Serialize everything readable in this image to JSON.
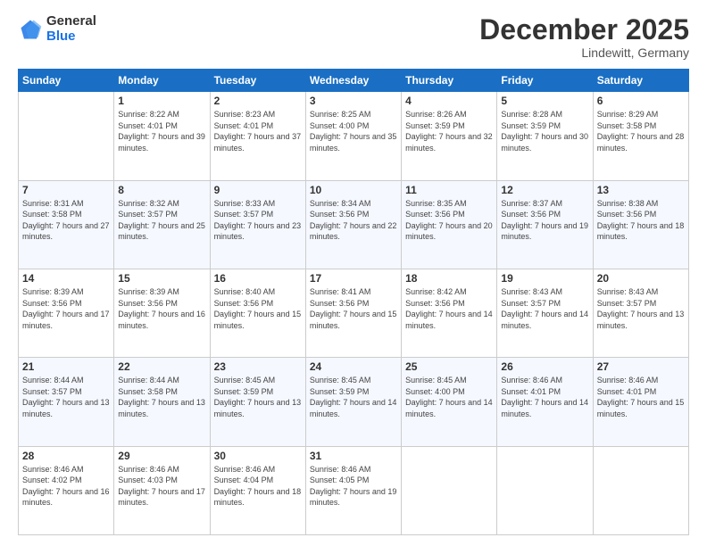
{
  "logo": {
    "general": "General",
    "blue": "Blue"
  },
  "title": "December 2025",
  "subtitle": "Lindewitt, Germany",
  "weekdays": [
    "Sunday",
    "Monday",
    "Tuesday",
    "Wednesday",
    "Thursday",
    "Friday",
    "Saturday"
  ],
  "weeks": [
    [
      {
        "day": "",
        "sunrise": "",
        "sunset": "",
        "daylight": ""
      },
      {
        "day": "1",
        "sunrise": "Sunrise: 8:22 AM",
        "sunset": "Sunset: 4:01 PM",
        "daylight": "Daylight: 7 hours and 39 minutes."
      },
      {
        "day": "2",
        "sunrise": "Sunrise: 8:23 AM",
        "sunset": "Sunset: 4:01 PM",
        "daylight": "Daylight: 7 hours and 37 minutes."
      },
      {
        "day": "3",
        "sunrise": "Sunrise: 8:25 AM",
        "sunset": "Sunset: 4:00 PM",
        "daylight": "Daylight: 7 hours and 35 minutes."
      },
      {
        "day": "4",
        "sunrise": "Sunrise: 8:26 AM",
        "sunset": "Sunset: 3:59 PM",
        "daylight": "Daylight: 7 hours and 32 minutes."
      },
      {
        "day": "5",
        "sunrise": "Sunrise: 8:28 AM",
        "sunset": "Sunset: 3:59 PM",
        "daylight": "Daylight: 7 hours and 30 minutes."
      },
      {
        "day": "6",
        "sunrise": "Sunrise: 8:29 AM",
        "sunset": "Sunset: 3:58 PM",
        "daylight": "Daylight: 7 hours and 28 minutes."
      }
    ],
    [
      {
        "day": "7",
        "sunrise": "Sunrise: 8:31 AM",
        "sunset": "Sunset: 3:58 PM",
        "daylight": "Daylight: 7 hours and 27 minutes."
      },
      {
        "day": "8",
        "sunrise": "Sunrise: 8:32 AM",
        "sunset": "Sunset: 3:57 PM",
        "daylight": "Daylight: 7 hours and 25 minutes."
      },
      {
        "day": "9",
        "sunrise": "Sunrise: 8:33 AM",
        "sunset": "Sunset: 3:57 PM",
        "daylight": "Daylight: 7 hours and 23 minutes."
      },
      {
        "day": "10",
        "sunrise": "Sunrise: 8:34 AM",
        "sunset": "Sunset: 3:56 PM",
        "daylight": "Daylight: 7 hours and 22 minutes."
      },
      {
        "day": "11",
        "sunrise": "Sunrise: 8:35 AM",
        "sunset": "Sunset: 3:56 PM",
        "daylight": "Daylight: 7 hours and 20 minutes."
      },
      {
        "day": "12",
        "sunrise": "Sunrise: 8:37 AM",
        "sunset": "Sunset: 3:56 PM",
        "daylight": "Daylight: 7 hours and 19 minutes."
      },
      {
        "day": "13",
        "sunrise": "Sunrise: 8:38 AM",
        "sunset": "Sunset: 3:56 PM",
        "daylight": "Daylight: 7 hours and 18 minutes."
      }
    ],
    [
      {
        "day": "14",
        "sunrise": "Sunrise: 8:39 AM",
        "sunset": "Sunset: 3:56 PM",
        "daylight": "Daylight: 7 hours and 17 minutes."
      },
      {
        "day": "15",
        "sunrise": "Sunrise: 8:39 AM",
        "sunset": "Sunset: 3:56 PM",
        "daylight": "Daylight: 7 hours and 16 minutes."
      },
      {
        "day": "16",
        "sunrise": "Sunrise: 8:40 AM",
        "sunset": "Sunset: 3:56 PM",
        "daylight": "Daylight: 7 hours and 15 minutes."
      },
      {
        "day": "17",
        "sunrise": "Sunrise: 8:41 AM",
        "sunset": "Sunset: 3:56 PM",
        "daylight": "Daylight: 7 hours and 15 minutes."
      },
      {
        "day": "18",
        "sunrise": "Sunrise: 8:42 AM",
        "sunset": "Sunset: 3:56 PM",
        "daylight": "Daylight: 7 hours and 14 minutes."
      },
      {
        "day": "19",
        "sunrise": "Sunrise: 8:43 AM",
        "sunset": "Sunset: 3:57 PM",
        "daylight": "Daylight: 7 hours and 14 minutes."
      },
      {
        "day": "20",
        "sunrise": "Sunrise: 8:43 AM",
        "sunset": "Sunset: 3:57 PM",
        "daylight": "Daylight: 7 hours and 13 minutes."
      }
    ],
    [
      {
        "day": "21",
        "sunrise": "Sunrise: 8:44 AM",
        "sunset": "Sunset: 3:57 PM",
        "daylight": "Daylight: 7 hours and 13 minutes."
      },
      {
        "day": "22",
        "sunrise": "Sunrise: 8:44 AM",
        "sunset": "Sunset: 3:58 PM",
        "daylight": "Daylight: 7 hours and 13 minutes."
      },
      {
        "day": "23",
        "sunrise": "Sunrise: 8:45 AM",
        "sunset": "Sunset: 3:59 PM",
        "daylight": "Daylight: 7 hours and 13 minutes."
      },
      {
        "day": "24",
        "sunrise": "Sunrise: 8:45 AM",
        "sunset": "Sunset: 3:59 PM",
        "daylight": "Daylight: 7 hours and 14 minutes."
      },
      {
        "day": "25",
        "sunrise": "Sunrise: 8:45 AM",
        "sunset": "Sunset: 4:00 PM",
        "daylight": "Daylight: 7 hours and 14 minutes."
      },
      {
        "day": "26",
        "sunrise": "Sunrise: 8:46 AM",
        "sunset": "Sunset: 4:01 PM",
        "daylight": "Daylight: 7 hours and 14 minutes."
      },
      {
        "day": "27",
        "sunrise": "Sunrise: 8:46 AM",
        "sunset": "Sunset: 4:01 PM",
        "daylight": "Daylight: 7 hours and 15 minutes."
      }
    ],
    [
      {
        "day": "28",
        "sunrise": "Sunrise: 8:46 AM",
        "sunset": "Sunset: 4:02 PM",
        "daylight": "Daylight: 7 hours and 16 minutes."
      },
      {
        "day": "29",
        "sunrise": "Sunrise: 8:46 AM",
        "sunset": "Sunset: 4:03 PM",
        "daylight": "Daylight: 7 hours and 17 minutes."
      },
      {
        "day": "30",
        "sunrise": "Sunrise: 8:46 AM",
        "sunset": "Sunset: 4:04 PM",
        "daylight": "Daylight: 7 hours and 18 minutes."
      },
      {
        "day": "31",
        "sunrise": "Sunrise: 8:46 AM",
        "sunset": "Sunset: 4:05 PM",
        "daylight": "Daylight: 7 hours and 19 minutes."
      },
      {
        "day": "",
        "sunrise": "",
        "sunset": "",
        "daylight": ""
      },
      {
        "day": "",
        "sunrise": "",
        "sunset": "",
        "daylight": ""
      },
      {
        "day": "",
        "sunrise": "",
        "sunset": "",
        "daylight": ""
      }
    ]
  ]
}
